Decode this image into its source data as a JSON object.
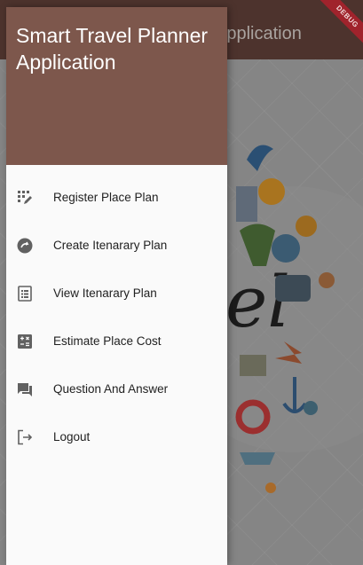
{
  "app_bar": {
    "title_fragment": "Application",
    "debug_label": "DEBUG"
  },
  "drawer": {
    "title": "Smart Travel Planner Application",
    "items": [
      {
        "label": "Register Place Plan",
        "icon": "edit-grid-icon"
      },
      {
        "label": "Create Itenarary Plan",
        "icon": "create-circle-icon"
      },
      {
        "label": "View Itenarary Plan",
        "icon": "list-icon"
      },
      {
        "label": "Estimate Place Cost",
        "icon": "calculator-icon"
      },
      {
        "label": "Question And Answer",
        "icon": "chat-icon"
      },
      {
        "label": "Logout",
        "icon": "logout-icon"
      }
    ]
  },
  "colors": {
    "drawer_header": "#7d574c",
    "app_bar": "#4d332d",
    "icon": "#616161",
    "debug_banner": "#a0232c"
  }
}
